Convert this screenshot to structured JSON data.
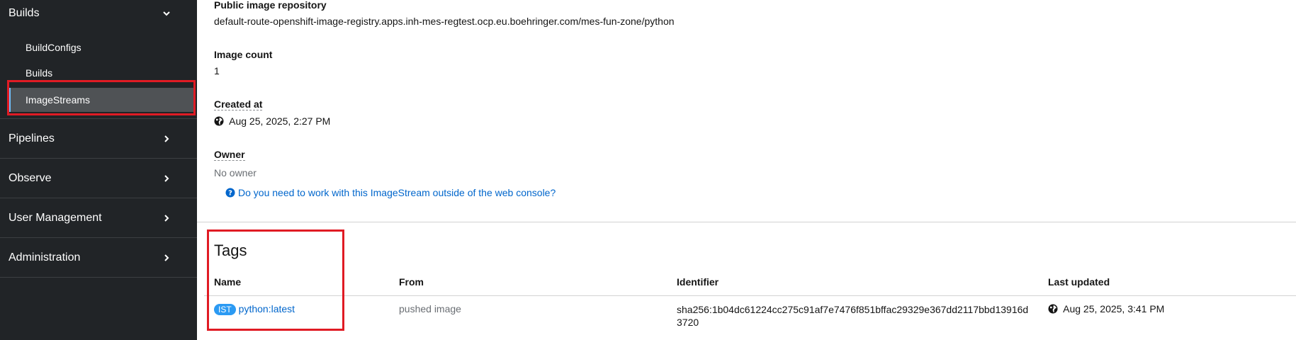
{
  "sidebar": {
    "builds": {
      "label": "Builds",
      "items": [
        {
          "label": "BuildConfigs"
        },
        {
          "label": "Builds"
        },
        {
          "label": "ImageStreams"
        }
      ]
    },
    "sections": [
      {
        "label": "Pipelines"
      },
      {
        "label": "Observe"
      },
      {
        "label": "User Management"
      },
      {
        "label": "Administration"
      }
    ]
  },
  "details": {
    "public_repo": {
      "label": "Public image repository",
      "value": "default-route-openshift-image-registry.apps.inh-mes-regtest.ocp.eu.boehringer.com/mes-fun-zone/python"
    },
    "image_count": {
      "label": "Image count",
      "value": "1"
    },
    "created_at": {
      "label": "Created at",
      "value": "Aug 25, 2025, 2:27 PM"
    },
    "owner": {
      "label": "Owner",
      "value": "No owner"
    },
    "help_link": "Do you need to work with this ImageStream outside of the web console?"
  },
  "tags": {
    "title": "Tags",
    "columns": [
      "Name",
      "From",
      "Identifier",
      "Last updated"
    ],
    "rows": [
      {
        "badge": "IST",
        "name": "python:latest",
        "from": "pushed image",
        "identifier_line1": "sha256:1b04dc61224cc275c91af7e7476f851bffac29329e367dd2117bbd13916d",
        "identifier_line2": "3720",
        "updated": "Aug 25, 2025, 3:41 PM"
      }
    ]
  },
  "colors": {
    "sidebar_bg": "#212427",
    "active_item_bg": "#4f5255",
    "link": "#0066cc",
    "highlight": "#e01b24",
    "badge": "#2b9af3"
  }
}
